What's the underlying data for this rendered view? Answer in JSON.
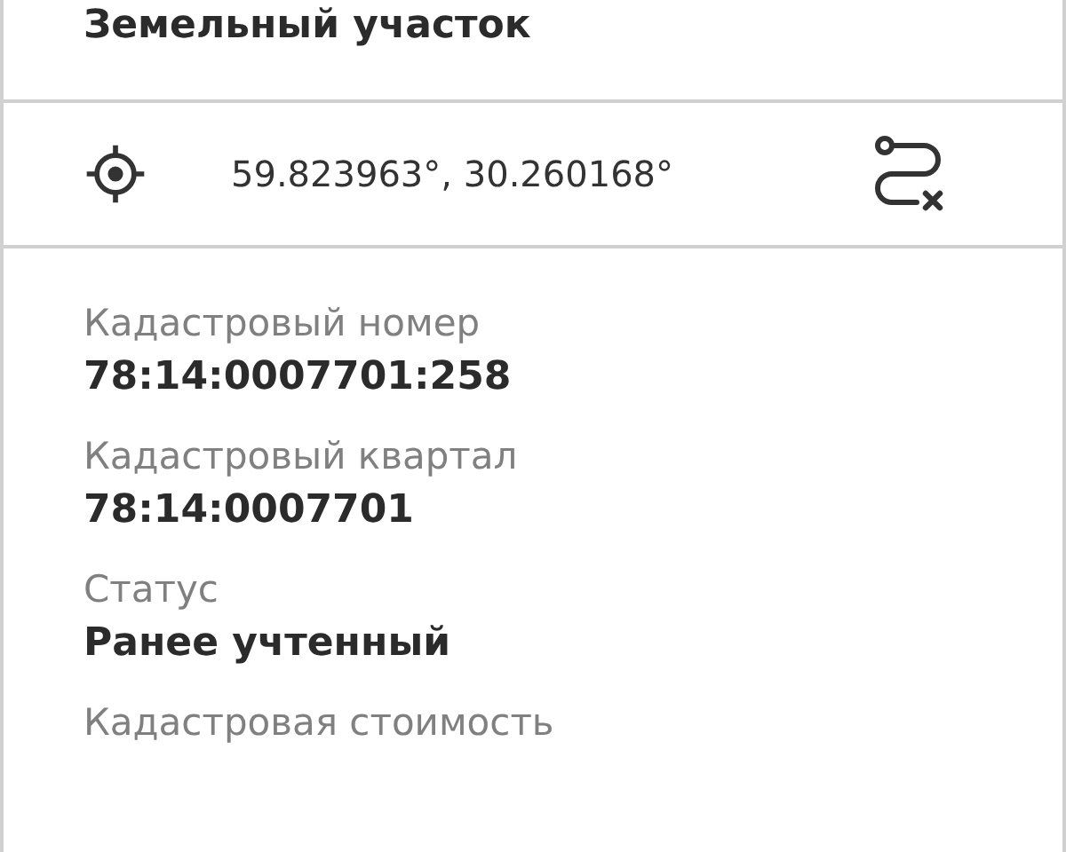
{
  "title": "Земельный участок",
  "coordinates": "59.823963°, 30.260168°",
  "fields": [
    {
      "label": "Кадастровый номер",
      "value": "78:14:0007701:258"
    },
    {
      "label": "Кадастровый квартал",
      "value": "78:14:0007701"
    },
    {
      "label": "Статус",
      "value": "Ранее учтенный"
    },
    {
      "label": "Кадастровая стоимость"
    }
  ]
}
